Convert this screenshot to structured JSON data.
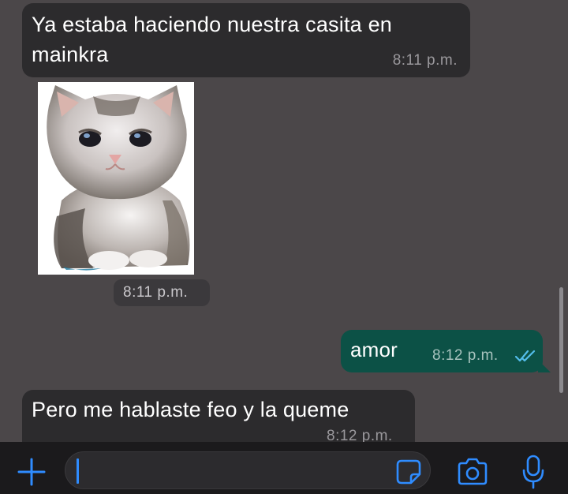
{
  "messages": [
    {
      "direction": "incoming",
      "text": "Ya estaba haciendo nuestra casita en mainkra",
      "time": "8:11 p.m."
    },
    {
      "direction": "incoming",
      "type": "sticker",
      "sticker": "crying-kitten",
      "time": "8:11 p.m."
    },
    {
      "direction": "outgoing",
      "text": "amor",
      "time": "8:12 p.m.",
      "status": "read"
    },
    {
      "direction": "incoming",
      "text": "Pero me hablaste feo y la queme",
      "time": "8:12 p.m."
    }
  ],
  "input_bar": {
    "value": "",
    "icons": [
      "plus-icon",
      "sticker-icon",
      "camera-icon",
      "microphone-icon"
    ]
  },
  "colors": {
    "background": "#4b4749",
    "incoming_bubble": "#2c2b2d",
    "outgoing_bubble": "#0c5146",
    "accent": "#2f8cff",
    "read_ticks": "#53bdeb"
  }
}
